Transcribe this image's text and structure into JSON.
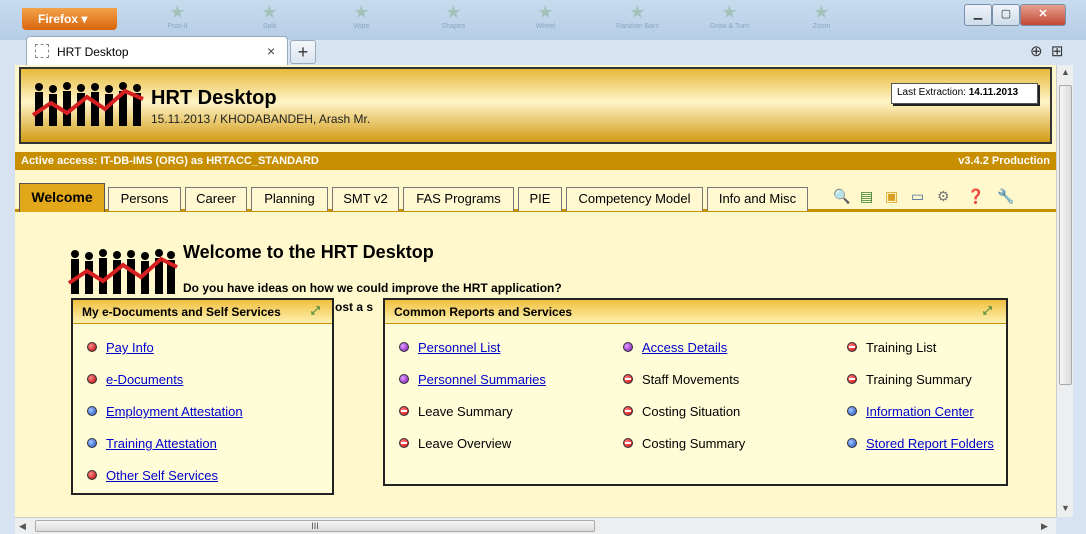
{
  "browser": {
    "menu_button": "Firefox ▾",
    "tab_title": "HRT Desktop",
    "tab_close": "×",
    "new_tab": "+",
    "taskbar_ghost": [
      "Post-It",
      "Split",
      "Wipe",
      "Shapes",
      "Wheel",
      "Random Bars",
      "Grow & Turn",
      "Zoom"
    ]
  },
  "header": {
    "title": "HRT Desktop",
    "subtitle": "15.11.2013 / KHODABANDEH, Arash Mr.",
    "last_extraction_label": "Last Extraction: ",
    "last_extraction_value": "14.11.2013"
  },
  "access_bar": {
    "left": "Active access: IT-DB-IMS (ORG) as HRTACC_STANDARD",
    "right": "v3.4.2 Production"
  },
  "menu": {
    "tabs": [
      "Welcome",
      "Persons",
      "Career",
      "Planning",
      "SMT v2",
      "FAS Programs",
      "PIE",
      "Competency Model",
      "Info and Misc"
    ],
    "active": "Welcome"
  },
  "welcome": {
    "title": "Welcome to the HRT Desktop",
    "question": "Do you have ideas on how we could improve the HRT application?",
    "partial": "ost a s"
  },
  "panels": {
    "self_services": {
      "title": "My e-Documents and Self Services",
      "items": [
        {
          "label": "Pay Info",
          "color": "red",
          "link": true
        },
        {
          "label": "e-Documents",
          "color": "red",
          "link": true
        },
        {
          "label": "Employment Attestation",
          "color": "blue",
          "link": true
        },
        {
          "label": "Training Attestation",
          "color": "blue",
          "link": true
        },
        {
          "label": "Other Self Services",
          "color": "red",
          "link": true
        }
      ]
    },
    "common_reports": {
      "title": "Common Reports and Services",
      "columns": [
        [
          {
            "label": "Personnel List",
            "color": "purple",
            "link": true
          },
          {
            "label": "Personnel Summaries",
            "color": "purple",
            "link": true
          },
          {
            "label": "Leave Summary",
            "color": "minus",
            "link": false
          },
          {
            "label": "Leave Overview",
            "color": "minus",
            "link": false
          }
        ],
        [
          {
            "label": "Access Details",
            "color": "purple",
            "link": true
          },
          {
            "label": "Staff Movements",
            "color": "minus",
            "link": false
          },
          {
            "label": "Costing Situation",
            "color": "minus",
            "link": false
          },
          {
            "label": "Costing Summary",
            "color": "minus",
            "link": false
          }
        ],
        [
          {
            "label": "Training List",
            "color": "minus",
            "link": false
          },
          {
            "label": "Training Summary",
            "color": "minus",
            "link": false
          },
          {
            "label": "Information Center",
            "color": "blue",
            "link": true
          },
          {
            "label": "Stored Report Folders",
            "color": "blue",
            "link": true
          }
        ]
      ]
    }
  },
  "scrollbar": {
    "h_grip": "III"
  },
  "colors": {
    "accent": "#c88f00",
    "tab_active": "#e2a819",
    "page_bg": "#fff8cc"
  }
}
